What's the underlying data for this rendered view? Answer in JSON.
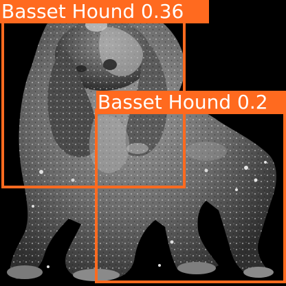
{
  "detections": [
    {
      "label": "Basset Hound",
      "confidence": "0.36"
    },
    {
      "label": "Basset Hound",
      "confidence": "0.2"
    }
  ],
  "colors": {
    "box": "#ff6a1f",
    "label_text": "#ffffff",
    "background": "#000000"
  }
}
